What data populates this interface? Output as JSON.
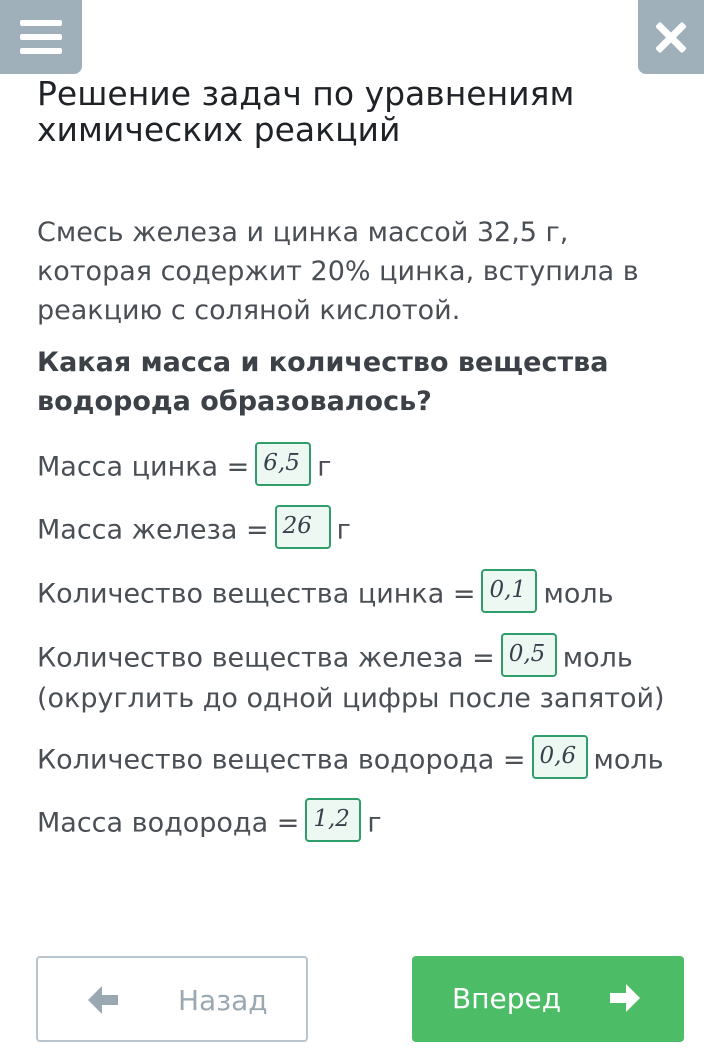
{
  "header": {
    "menu_icon": "hamburger-menu-icon",
    "close_icon": "close-icon",
    "title": "Решение задач по уравнениям химических реакций"
  },
  "task": {
    "problem": "Смесь железа и цинка массой 32,5 г, которая содержит 20% цинка, вступила в реакцию с соляной кислотой.",
    "question": "Какая масса и количество вещества водорода образовалось?"
  },
  "answers": [
    {
      "label": "Масса цинка =",
      "value": "6,5",
      "unit": "г"
    },
    {
      "label": "Масса железа =",
      "value": "26",
      "unit": "г"
    },
    {
      "label": "Количество вещества цинка =",
      "value": "0,1",
      "unit": "моль"
    },
    {
      "label": "Количество вещества железа =",
      "value": "0,5",
      "unit": "моль",
      "note": "(округлить до одной цифры после запятой)"
    },
    {
      "label": "Количество вещества водорода =",
      "value": "0,6",
      "unit": "моль"
    },
    {
      "label": "Масса водорода =",
      "value": "1,2",
      "unit": "г"
    }
  ],
  "navigation": {
    "back_label": "Назад",
    "next_label": "Вперед",
    "back_icon": "arrow-left-icon",
    "next_icon": "arrow-right-icon"
  },
  "colors": {
    "header_button": "#9fb0bb",
    "answer_border": "#2f9e6a",
    "next_button": "#4cbc67",
    "back_border": "#b9c4cc"
  }
}
